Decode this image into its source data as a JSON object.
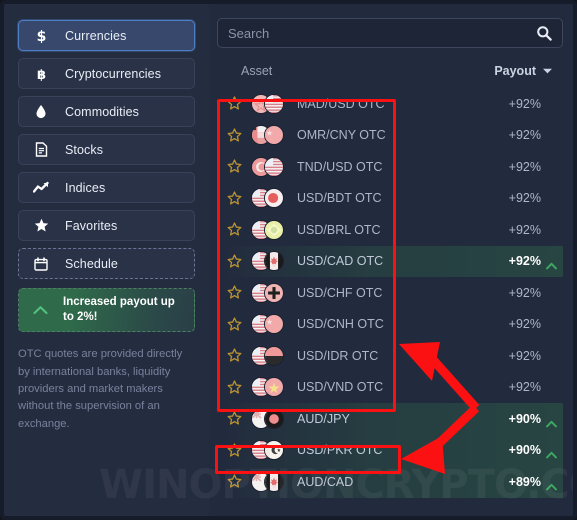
{
  "sidebar": {
    "items": [
      {
        "label": "Currencies",
        "icon": "dollar-icon",
        "active": true,
        "style": "solid"
      },
      {
        "label": "Cryptocurrencies",
        "icon": "bitcoin-icon",
        "active": false,
        "style": "solid"
      },
      {
        "label": "Commodities",
        "icon": "droplet-icon",
        "active": false,
        "style": "solid"
      },
      {
        "label": "Stocks",
        "icon": "document-icon",
        "active": false,
        "style": "solid"
      },
      {
        "label": "Indices",
        "icon": "trend-up-icon",
        "active": false,
        "style": "solid"
      },
      {
        "label": "Favorites",
        "icon": "star-icon",
        "active": false,
        "style": "solid"
      },
      {
        "label": "Schedule",
        "icon": "calendar-icon",
        "active": false,
        "style": "dashed"
      }
    ],
    "promo": {
      "label": "Increased payout up to 2%!",
      "icon": "chevron-up-icon"
    },
    "otc_note": "OTC quotes are provided directly by international banks, liquidity providers and market makers without the supervision of an exchange."
  },
  "search": {
    "placeholder": "Search",
    "value": "",
    "icon": "search-icon"
  },
  "columns": {
    "asset": "Asset",
    "payout": "Payout",
    "sort_icon": "chevron-down-icon"
  },
  "assets": [
    {
      "name": "MAD/USD OTC",
      "payout": "+92%",
      "highlighted": false,
      "trend": false,
      "flag1": "ma",
      "flag2": "us"
    },
    {
      "name": "OMR/CNY OTC",
      "payout": "+92%",
      "highlighted": false,
      "trend": false,
      "flag1": "om",
      "flag2": "cn"
    },
    {
      "name": "TND/USD OTC",
      "payout": "+92%",
      "highlighted": false,
      "trend": false,
      "flag1": "tn",
      "flag2": "us"
    },
    {
      "name": "USD/BDT OTC",
      "payout": "+92%",
      "highlighted": false,
      "trend": false,
      "flag1": "us",
      "flag2": "bd"
    },
    {
      "name": "USD/BRL OTC",
      "payout": "+92%",
      "highlighted": false,
      "trend": false,
      "flag1": "us",
      "flag2": "br"
    },
    {
      "name": "USD/CAD OTC",
      "payout": "+92%",
      "highlighted": true,
      "trend": true,
      "flag1": "us",
      "flag2": "ca"
    },
    {
      "name": "USD/CHF OTC",
      "payout": "+92%",
      "highlighted": false,
      "trend": false,
      "flag1": "us",
      "flag2": "ch"
    },
    {
      "name": "USD/CNH OTC",
      "payout": "+92%",
      "highlighted": false,
      "trend": false,
      "flag1": "us",
      "flag2": "cn"
    },
    {
      "name": "USD/IDR OTC",
      "payout": "+92%",
      "highlighted": false,
      "trend": false,
      "flag1": "us",
      "flag2": "id"
    },
    {
      "name": "USD/VND OTC",
      "payout": "+92%",
      "highlighted": false,
      "trend": false,
      "flag1": "us",
      "flag2": "vn"
    },
    {
      "name": "AUD/JPY",
      "payout": "+90%",
      "highlighted": true,
      "trend": true,
      "flag1": "au",
      "flag2": "jp"
    },
    {
      "name": "USD/PKR OTC",
      "payout": "+90%",
      "highlighted": true,
      "trend": true,
      "flag1": "us",
      "flag2": "pk"
    },
    {
      "name": "AUD/CAD",
      "payout": "+89%",
      "highlighted": true,
      "trend": true,
      "flag1": "au",
      "flag2": "ca"
    }
  ],
  "annotations": {
    "box_otc_group": "red-highlight-box-otc-assets",
    "box_usd_pkr": "red-highlight-box-usd-pkr",
    "arrow": "red-double-arrow-pointing-left"
  },
  "watermark": {
    "text": "WINOPTIONCRYPTO.COM"
  },
  "colors": {
    "panel_bg": "#222a3d",
    "sidebar_bg": "#242c40",
    "accent_blue": "#4e7fc4",
    "green": "#53c07f",
    "annotation_red": "#fb1111",
    "star_gold": "#b99233"
  }
}
